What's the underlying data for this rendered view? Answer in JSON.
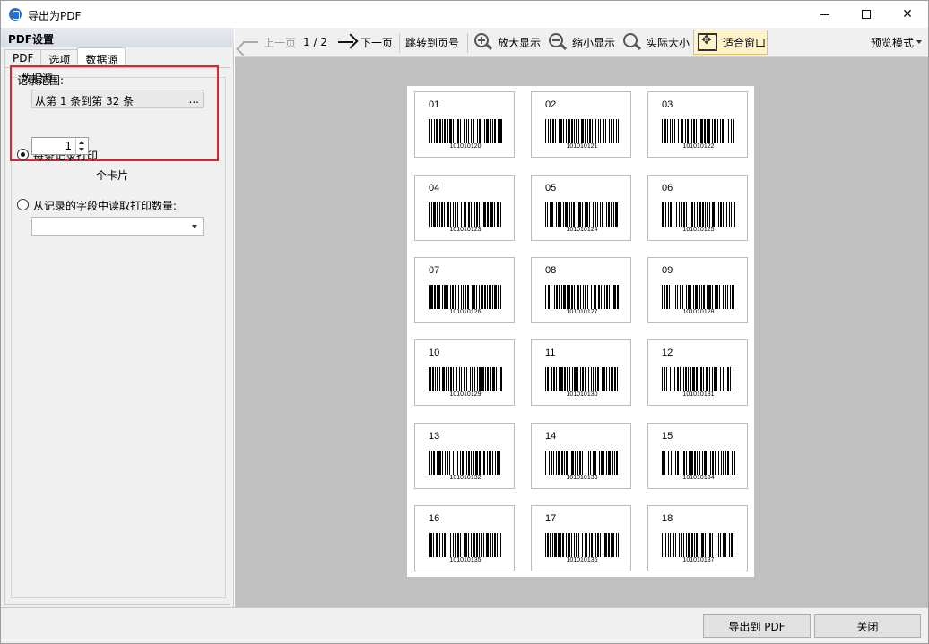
{
  "window": {
    "title": "导出为PDF"
  },
  "left_panel": {
    "header": "PDF设置",
    "tabs": [
      {
        "label": "PDF",
        "active": false
      },
      {
        "label": "选项",
        "active": false
      },
      {
        "label": "数据源",
        "active": true
      }
    ],
    "group_title": "数据源",
    "range_label": "记录范围:",
    "range_value": "从第 1 条到第 32 条",
    "range_more": "...",
    "per_record_label": "每条记录打印",
    "per_record_checked": true,
    "copies_value": "1",
    "copies_unit": "个卡片",
    "from_field_label": "从记录的字段中读取打印数量:",
    "from_field_checked": false,
    "from_field_select": ""
  },
  "toolbar": {
    "prev_label": "上一页",
    "page_indicator": "1 / 2",
    "next_label": "下一页",
    "goto_label": "跳转到页号",
    "zoom_in_label": "放大显示",
    "zoom_out_label": "缩小显示",
    "actual_size_label": "实际大小",
    "fit_window_label": "适合窗口",
    "preview_mode_label": "预览模式"
  },
  "preview": {
    "cards": [
      {
        "num": "01",
        "code": "101010120"
      },
      {
        "num": "02",
        "code": "101010121"
      },
      {
        "num": "03",
        "code": "101010122"
      },
      {
        "num": "04",
        "code": "101010123"
      },
      {
        "num": "05",
        "code": "101010124"
      },
      {
        "num": "06",
        "code": "101010125"
      },
      {
        "num": "07",
        "code": "101010126"
      },
      {
        "num": "08",
        "code": "101010127"
      },
      {
        "num": "09",
        "code": "101010128"
      },
      {
        "num": "10",
        "code": "101010129"
      },
      {
        "num": "11",
        "code": "101010130"
      },
      {
        "num": "12",
        "code": "101010131"
      },
      {
        "num": "13",
        "code": "101010132"
      },
      {
        "num": "14",
        "code": "101010133"
      },
      {
        "num": "15",
        "code": "101010134"
      },
      {
        "num": "16",
        "code": "101010135"
      },
      {
        "num": "17",
        "code": "101010136"
      },
      {
        "num": "18",
        "code": "101010137"
      }
    ]
  },
  "buttons": {
    "export_label": "导出到 PDF",
    "close_label": "关闭"
  },
  "colors": {
    "highlight_border": "#e0242c",
    "fit_button_bg": "#fff3c9",
    "preview_bg": "#c0c0c0",
    "app_icon": "#1e6fd9"
  }
}
